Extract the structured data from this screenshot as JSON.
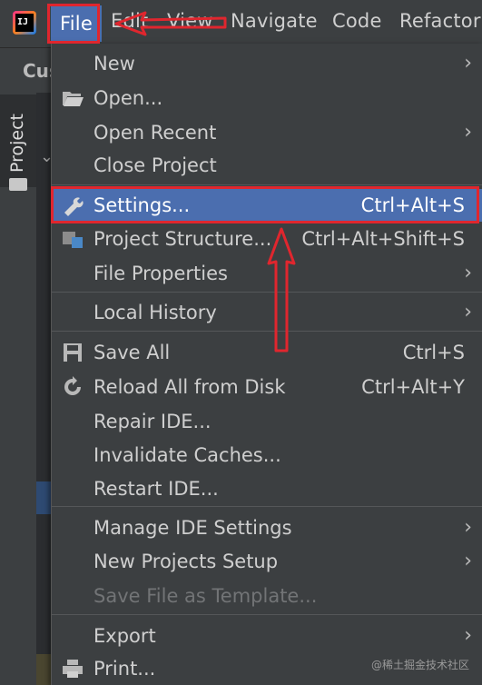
{
  "app": {
    "logo_text": "IJ"
  },
  "menubar": {
    "items": [
      {
        "label": "File"
      },
      {
        "label": "Edit"
      },
      {
        "label": "View"
      },
      {
        "label": "Navigate"
      },
      {
        "label": "Code"
      },
      {
        "label": "Refactor"
      }
    ]
  },
  "background": {
    "toolbar_text": "Cus",
    "project_tab": "Project"
  },
  "file_menu": {
    "items": [
      {
        "label": "New",
        "shortcut": "",
        "submenu": true,
        "icon": ""
      },
      {
        "label": "Open...",
        "shortcut": "",
        "submenu": false,
        "icon": "folder-open-icon"
      },
      {
        "label": "Open Recent",
        "shortcut": "",
        "submenu": true,
        "icon": ""
      },
      {
        "label": "Close Project",
        "shortcut": "",
        "submenu": false,
        "icon": ""
      },
      {
        "label": "Settings...",
        "shortcut": "Ctrl+Alt+S",
        "submenu": false,
        "icon": "wrench-icon",
        "selected": true
      },
      {
        "label": "Project Structure...",
        "shortcut": "Ctrl+Alt+Shift+S",
        "submenu": false,
        "icon": "project-structure-icon"
      },
      {
        "label": "File Properties",
        "shortcut": "",
        "submenu": true,
        "icon": ""
      },
      {
        "label": "Local History",
        "shortcut": "",
        "submenu": true,
        "icon": ""
      },
      {
        "label": "Save All",
        "shortcut": "Ctrl+S",
        "submenu": false,
        "icon": "save-icon"
      },
      {
        "label": "Reload All from Disk",
        "shortcut": "Ctrl+Alt+Y",
        "submenu": false,
        "icon": "reload-icon"
      },
      {
        "label": "Repair IDE...",
        "shortcut": "",
        "submenu": false,
        "icon": ""
      },
      {
        "label": "Invalidate Caches...",
        "shortcut": "",
        "submenu": false,
        "icon": ""
      },
      {
        "label": "Restart IDE...",
        "shortcut": "",
        "submenu": false,
        "icon": ""
      },
      {
        "label": "Manage IDE Settings",
        "shortcut": "",
        "submenu": true,
        "icon": ""
      },
      {
        "label": "New Projects Setup",
        "shortcut": "",
        "submenu": true,
        "icon": ""
      },
      {
        "label": "Save File as Template...",
        "shortcut": "",
        "submenu": false,
        "icon": "",
        "disabled": true
      },
      {
        "label": "Export",
        "shortcut": "",
        "submenu": true,
        "icon": ""
      },
      {
        "label": "Print...",
        "shortcut": "",
        "submenu": false,
        "icon": "print-icon"
      }
    ]
  },
  "watermark": "@稀土掘金技术社区",
  "colors": {
    "selection": "#4b6eaf",
    "annotation": "#e0262e",
    "menu_bg": "#3c3f41"
  }
}
